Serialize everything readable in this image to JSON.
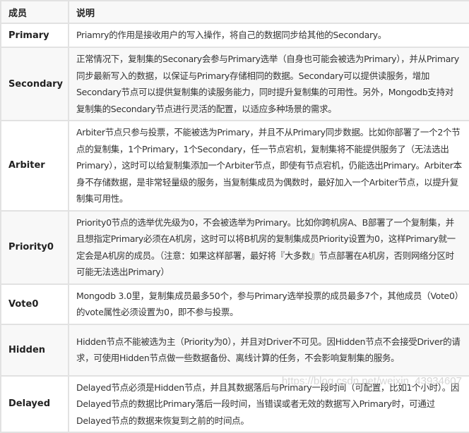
{
  "table": {
    "headers": [
      "成员",
      "说明"
    ],
    "rows": [
      {
        "member": "Primary",
        "description": "Priamry的作用是接收用户的写入操作，将自己的数据同步给其他的Secondary。"
      },
      {
        "member": "Secondary",
        "description": "正常情况下，复制集的Seconary会参与Primary选举（自身也可能会被选为Primary），并从Primary同步最新写入的数据，以保证与Primary存储相同的数据。Secondary可以提供读服务，增加Secondary节点可以提供复制集的读服务能力，同时提升复制集的可用性。另外，Mongodb支持对复制集的Secondary节点进行灵活的配置，以适应多种场景的需求。"
      },
      {
        "member": "Arbiter",
        "description": "Arbiter节点只参与投票，不能被选为Primary，并且不从Primary同步数据。比如你部署了一个2个节点的复制集，1个Primary，1个Secondary，任一节点宕机，复制集将不能提供服务了（无法选出Primary），这时可以给复制集添加一个Arbiter节点，即使有节点宕机，仍能选出Primary。Arbiter本身不存储数据，是非常轻量级的服务，当复制集成员为偶数时，最好加入一个Arbiter节点，以提升复制集可用性。"
      },
      {
        "member": "Priority0",
        "description": "Priority0节点的选举优先级为0，不会被选举为Primary。比如你跨机房A、B部署了一个复制集，并且想指定Primary必须在A机房，这时可以将B机房的复制集成员Priority设置为0，这样Primary就一定会是A机房的成员。（注意：如果这样部署，最好将『大多数』节点部署在A机房，否则网络分区时可能无法选出Primary）"
      },
      {
        "member": "Vote0",
        "description": "Mongodb 3.0里，复制集成员最多50个，参与Primary选举投票的成员最多7个，其他成员（Vote0）的vote属性必须设置为0，即不参与投票。"
      },
      {
        "member": "Hidden",
        "description": "Hidden节点不能被选为主（Priority为0），并且对Driver不可见。因Hidden节点不会接受Driver的请求，可使用Hidden节点做一些数据备份、离线计算的任务，不会影响复制集的服务。"
      },
      {
        "member": "Delayed",
        "description": "Delayed节点必须是Hidden节点，并且其数据落后与Primary一段时间（可配置，比如1个小时）。因Delayed节点的数据比Primary落后一段时间，当错误或者无效的数据写入Primary时，可通过Delayed节点的数据来恢复到之前的时间点。"
      }
    ]
  },
  "watermark": "https://blog.csdn.net/weixin_43934607"
}
